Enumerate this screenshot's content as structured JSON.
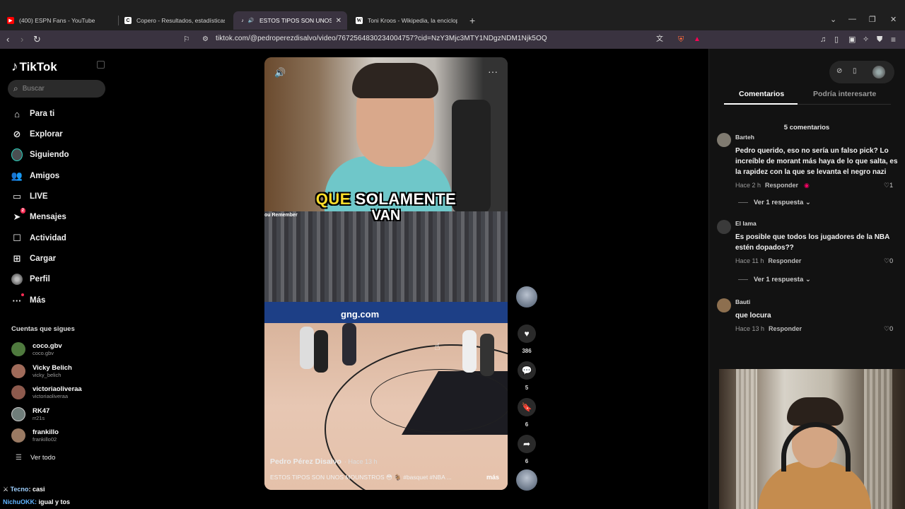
{
  "browser": {
    "tabs": [
      {
        "label": "(400) ESPN Fans - YouTube",
        "favicon": "youtube-icon",
        "color": "#ff0000"
      },
      {
        "label": "Copero - Resultados, estadísticas, an",
        "favicon": "copero-icon",
        "color": "#ffffff"
      },
      {
        "label": "ESTOS TIPOS SON UNOS MO",
        "favicon": "tiktok-icon",
        "color": "#ffffff",
        "active": true
      },
      {
        "label": "Toni Kroos - Wikipedia, la encicloped",
        "favicon": "wikipedia-icon",
        "color": "#ffffff"
      }
    ],
    "url": "tiktok.com/@pedroperezdisalvo/video/7672564830234004757?cid=NzY3Mjc3MTY1NDgzNDM1Njk5OQ"
  },
  "sidebar": {
    "logo": "TikTok",
    "search_placeholder": "Buscar",
    "nav": [
      {
        "label": "Para ti",
        "icon": "home-icon"
      },
      {
        "label": "Explorar",
        "icon": "compass-icon"
      },
      {
        "label": "Siguiendo",
        "icon": "following-avatar-icon"
      },
      {
        "label": "Amigos",
        "icon": "friends-icon"
      },
      {
        "label": "LIVE",
        "icon": "live-icon"
      },
      {
        "label": "Mensajes",
        "icon": "messages-icon",
        "badge": "2"
      },
      {
        "label": "Actividad",
        "icon": "activity-icon"
      },
      {
        "label": "Cargar",
        "icon": "upload-icon"
      },
      {
        "label": "Perfil",
        "icon": "profile-avatar-icon"
      },
      {
        "label": "Más",
        "icon": "more-icon"
      }
    ],
    "following_title": "Cuentas que sigues",
    "accounts": [
      {
        "name": "coco.gbv",
        "handle": "coco.gbv",
        "color": "#4f7a3e"
      },
      {
        "name": "Vicky Belich",
        "handle": "vicky_belich",
        "color": "#a06b5a"
      },
      {
        "name": "victoriaoliveraa",
        "handle": "victoriaoliveraa",
        "color": "#8d5a4d"
      },
      {
        "name": "RK47",
        "handle": "rr21s",
        "color": "#6f7d7a"
      },
      {
        "name": "frankillo",
        "handle": "frankillo02",
        "color": "#9a7a63"
      }
    ],
    "see_all": "Ver todo"
  },
  "chat": [
    {
      "user": "Tecno",
      "text": "casi"
    },
    {
      "user": "NichuOKK:",
      "text": "igual y tos"
    }
  ],
  "video": {
    "caption_highlight": "QUE",
    "caption_rest": "SOLAMENTE",
    "caption_line2": "VAN",
    "inset_label": "ou Remember",
    "ad_text": "gng.com",
    "author": "Pedro Pérez Disalvo",
    "time": "· Hace 13 h",
    "description": "ESTOS TIPOS SON UNOS MOUNSTROS 😳 🐐 #basquet #NBA ...",
    "more": "más"
  },
  "actions": {
    "likes": "386",
    "comments": "5",
    "saves": "6",
    "shares": "6"
  },
  "panel": {
    "tab_comments": "Comentarios",
    "tab_related": "Podría interesarte",
    "count": "5 comentarios",
    "comments": [
      {
        "name": "Barteh",
        "text": "Pedro querido, eso no sería un falso pick? Lo increíble de morant más haya de lo que salta, es la rapidez con la que se levanta el negro nazi",
        "time": "Hace 2 h",
        "reply": "Responder",
        "likes": "1",
        "replies": "Ver 1 respuesta",
        "color": "#7f7a70"
      },
      {
        "name": "El lama",
        "text": "Es posible que todos los jugadores de la NBA estén dopados??",
        "time": "Hace 11 h",
        "reply": "Responder",
        "likes": "0",
        "replies": "Ver 1 respuesta",
        "color": "#3a3a3a"
      },
      {
        "name": "Bauti",
        "text": "que locura",
        "time": "Hace 13 h",
        "reply": "Responder",
        "likes": "0",
        "color": "#8d6f4f"
      }
    ]
  }
}
